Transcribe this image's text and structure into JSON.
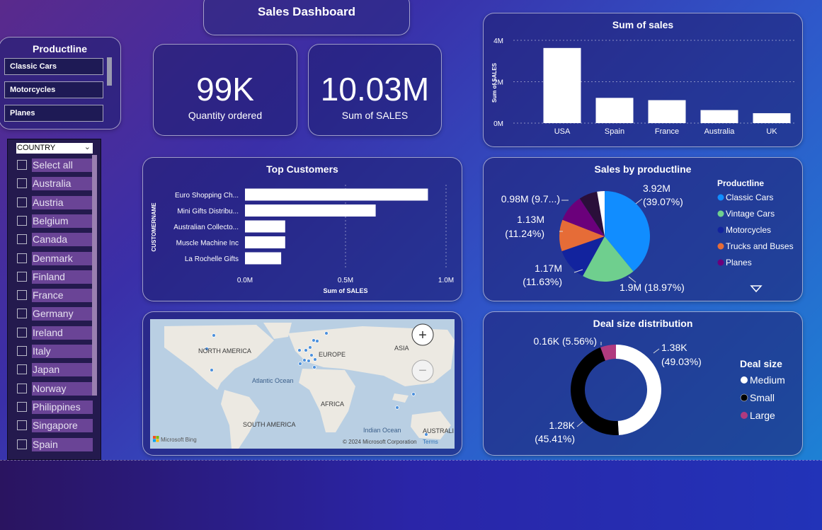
{
  "title": "Sales Dashboard",
  "productline_slicer": {
    "title": "Productline",
    "items": [
      "Classic Cars",
      "Motorcycles",
      "Planes"
    ]
  },
  "kpis": [
    {
      "value": "99K",
      "label": "Quantity ordered"
    },
    {
      "value": "10.03M",
      "label": "Sum of SALES"
    }
  ],
  "country_slicer": {
    "header": "COUNTRY",
    "items": [
      "Select all",
      "Australia",
      "Austria",
      "Belgium",
      "Canada",
      "Denmark",
      "Finland",
      "France",
      "Germany",
      "Ireland",
      "Italy",
      "Japan",
      "Norway",
      "Philippines",
      "Singapore",
      "Spain"
    ]
  },
  "colors": {
    "classic_cars": "#118DFF",
    "vintage_cars": "#6FCF8E",
    "motorcycles": "#12239E",
    "trucks_buses": "#E66C37",
    "planes": "#6B007B",
    "medium": "#FFFFFF",
    "small": "#000000",
    "large": "#B03A7F"
  },
  "map": {
    "labels": [
      "NORTH AMERICA",
      "EUROPE",
      "ASIA",
      "Atlantic Ocean",
      "AFRICA",
      "SOUTH AMERICA",
      "Indian Ocean",
      "AUSTRALI"
    ],
    "attribution_left": "Microsoft Bing",
    "attribution_right": "© 2024 Microsoft Corporation",
    "terms": "Terms"
  },
  "chart_data": [
    {
      "id": "sum_of_sales",
      "type": "bar",
      "title": "Sum of sales",
      "ylabel": "Sum of SALES",
      "xlabel": "",
      "categories": [
        "USA",
        "Spain",
        "France",
        "Australia",
        "UK"
      ],
      "values": [
        3.63,
        1.22,
        1.11,
        0.63,
        0.48
      ],
      "ylim": [
        0,
        4
      ],
      "yticks": [
        "0M",
        "2M",
        "4M"
      ],
      "grid": true
    },
    {
      "id": "top_customers",
      "type": "bar",
      "orientation": "horizontal",
      "title": "Top Customers",
      "xlabel": "Sum of SALES",
      "ylabel": "CUSTOMERNAME",
      "categories": [
        "Euro Shopping Ch...",
        "Mini Gifts Distribu...",
        "Australian Collecto...",
        "Muscle Machine Inc",
        "La Rochelle Gifts"
      ],
      "values": [
        0.91,
        0.65,
        0.2,
        0.2,
        0.18
      ],
      "xlim": [
        0,
        1.0
      ],
      "xticks": [
        "0.0M",
        "0.5M",
        "1.0M"
      ],
      "grid": true
    },
    {
      "id": "sales_by_productline",
      "type": "pie",
      "title": "Sales by productline",
      "legend_title": "Productline",
      "legend_position": "right",
      "slices": [
        {
          "name": "Classic Cars",
          "value": 3.92,
          "label": [
            "3.92M",
            "(39.07%)"
          ],
          "color": "#118DFF"
        },
        {
          "name": "Vintage Cars",
          "value": 1.9,
          "label": [
            "1.9M (18.97%)"
          ],
          "color": "#6FCF8E"
        },
        {
          "name": "Motorcycles",
          "value": 1.17,
          "label": [
            "1.17M",
            "(11.63%)"
          ],
          "color": "#12239E"
        },
        {
          "name": "Trucks and Buses",
          "value": 1.13,
          "label": [
            "1.13M",
            "(11.24%)"
          ],
          "color": "#E66C37"
        },
        {
          "name": "Planes",
          "value": 0.98,
          "label": [
            "0.98M (9.7...)"
          ],
          "color": "#6B007B"
        },
        {
          "name": "",
          "value": 0.66,
          "label": [],
          "color": "#2a0f3a"
        },
        {
          "name": "",
          "value": 0.27,
          "label": [],
          "color": "#FFFFFF"
        }
      ]
    },
    {
      "id": "deal_size",
      "type": "pie",
      "donut": true,
      "title": "Deal size distribution",
      "legend_title": "Deal size",
      "legend_position": "right",
      "slices": [
        {
          "name": "Medium",
          "value": 49.03,
          "label": [
            "1.38K",
            "(49.03%)"
          ],
          "color": "#FFFFFF"
        },
        {
          "name": "Small",
          "value": 45.41,
          "label": [
            "1.28K",
            "(45.41%)"
          ],
          "color": "#000000"
        },
        {
          "name": "Large",
          "value": 5.56,
          "label": [
            "0.16K (5.56%)"
          ],
          "color": "#B03A7F"
        }
      ]
    }
  ]
}
